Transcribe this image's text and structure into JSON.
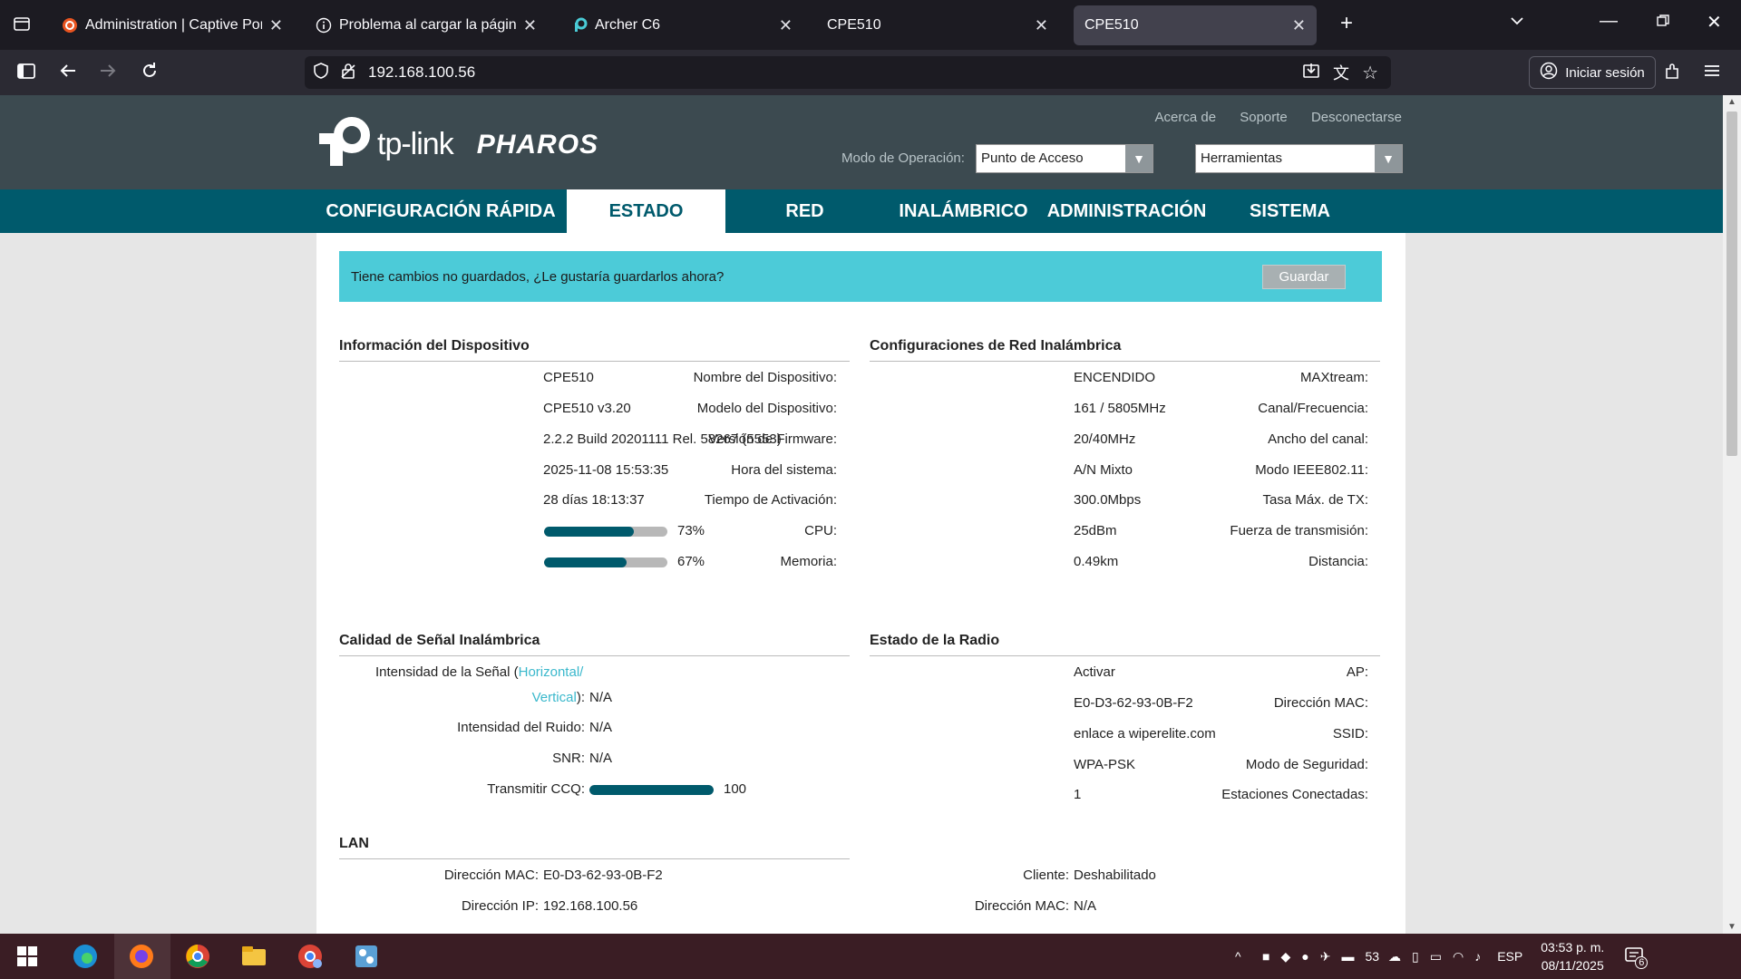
{
  "tabs": [
    {
      "title": "Administration | Captive Portal |",
      "active": false
    },
    {
      "title": "Problema al cargar la página",
      "active": false
    },
    {
      "title": "Archer C6",
      "active": false
    },
    {
      "title": "CPE510",
      "active": false
    },
    {
      "title": "CPE510",
      "active": true
    }
  ],
  "navbar": {
    "url": "192.168.100.56",
    "signin_label": "Iniciar sesión"
  },
  "header": {
    "brand": "tp-link",
    "product": "PHAROS",
    "links": {
      "about": "Acerca de",
      "support": "Soporte",
      "logout": "Desconectarse"
    },
    "op_mode_label": "Modo de Operación:",
    "op_mode_value": "Punto de Acceso",
    "tools_value": "Herramientas"
  },
  "mainnav": {
    "quick": "CONFIGURACIÓN RÁPIDA",
    "status": "ESTADO",
    "network": "RED",
    "wireless": "INALÁMBRICO",
    "admin": "ADMINISTRACIÓN",
    "system": "SISTEMA"
  },
  "banner": {
    "message": "Tiene cambios no guardados, ¿Le gustaría guardarlos ahora?",
    "save_label": "Guardar"
  },
  "device_info": {
    "title": "Información del Dispositivo",
    "name_label": "Nombre del Dispositivo:",
    "name": "CPE510",
    "model_label": "Modelo del Dispositivo:",
    "model": "CPE510 v3.20",
    "firmware_label": "Versión de Firmware:",
    "firmware": "2.2.2 Build 20201111 Rel. 58267 (5553)",
    "time_label": "Hora del sistema:",
    "time": "2025-11-08 15:53:35",
    "uptime_label": "Tiempo de Activación:",
    "uptime": "28 días 18:13:37",
    "cpu_label": "CPU:",
    "cpu": "73%",
    "cpu_fraction": 0.73,
    "mem_label": "Memoria:",
    "mem": "67%",
    "mem_fraction": 0.67
  },
  "wireless_settings": {
    "title": "Configuraciones de Red Inalámbrica",
    "maxtream_label": "MAXtream:",
    "maxtream": "ENCENDIDO",
    "channel_label": "Canal/Frecuencia:",
    "channel": "161 / 5805MHz",
    "width_label": "Ancho del canal:",
    "width": "20/40MHz",
    "mode_label": "Modo IEEE802.11:",
    "mode": "A/N Mixto",
    "rate_label": "Tasa Máx. de TX:",
    "rate": "300.0Mbps",
    "power_label": "Fuerza de transmisión:",
    "power": "25dBm",
    "distance_label": "Distancia:",
    "distance": "0.49km"
  },
  "signal_quality": {
    "title": "Calidad de Señal Inalámbrica",
    "strength_label_a": "Intensidad de la Señal (",
    "strength_link_h": "Horizontal/",
    "strength_link_v": "Vertical",
    "strength_label_b": "):",
    "strength": "N/A",
    "noise_label": "Intensidad del Ruido:",
    "noise": "N/A",
    "snr_label": "SNR:",
    "snr": "N/A",
    "ccq_label": "Transmitir CCQ:",
    "ccq": "100",
    "ccq_fraction": 1.0
  },
  "radio_status": {
    "title": "Estado de la Radio",
    "ap_label": "AP:",
    "ap": "Activar",
    "mac_label": "Dirección MAC:",
    "mac": "E0-D3-62-93-0B-F2",
    "ssid_label": "SSID:",
    "ssid": "enlace a wiperelite.com",
    "security_label": "Modo de Seguridad:",
    "security": "WPA-PSK",
    "stations_label": "Estaciones Conectadas:",
    "stations": "1"
  },
  "lan": {
    "title": "LAN",
    "mac_label": "Dirección MAC:",
    "mac": "E0-D3-62-93-0B-F2",
    "ip_label": "Dirección IP:",
    "ip": "192.168.100.56"
  },
  "client": {
    "client_label": "Cliente:",
    "client": "Deshabilitado",
    "mac_label": "Dirección MAC:",
    "mac": "N/A"
  },
  "tray": {
    "weather": "53",
    "language": "ESP",
    "time": "03:53 p. m.",
    "date": "08/11/2025",
    "notifications": "6"
  },
  "colors": {
    "teal": "#005a6c",
    "banner": "#4ccbd8",
    "header": "#3c4a50"
  }
}
